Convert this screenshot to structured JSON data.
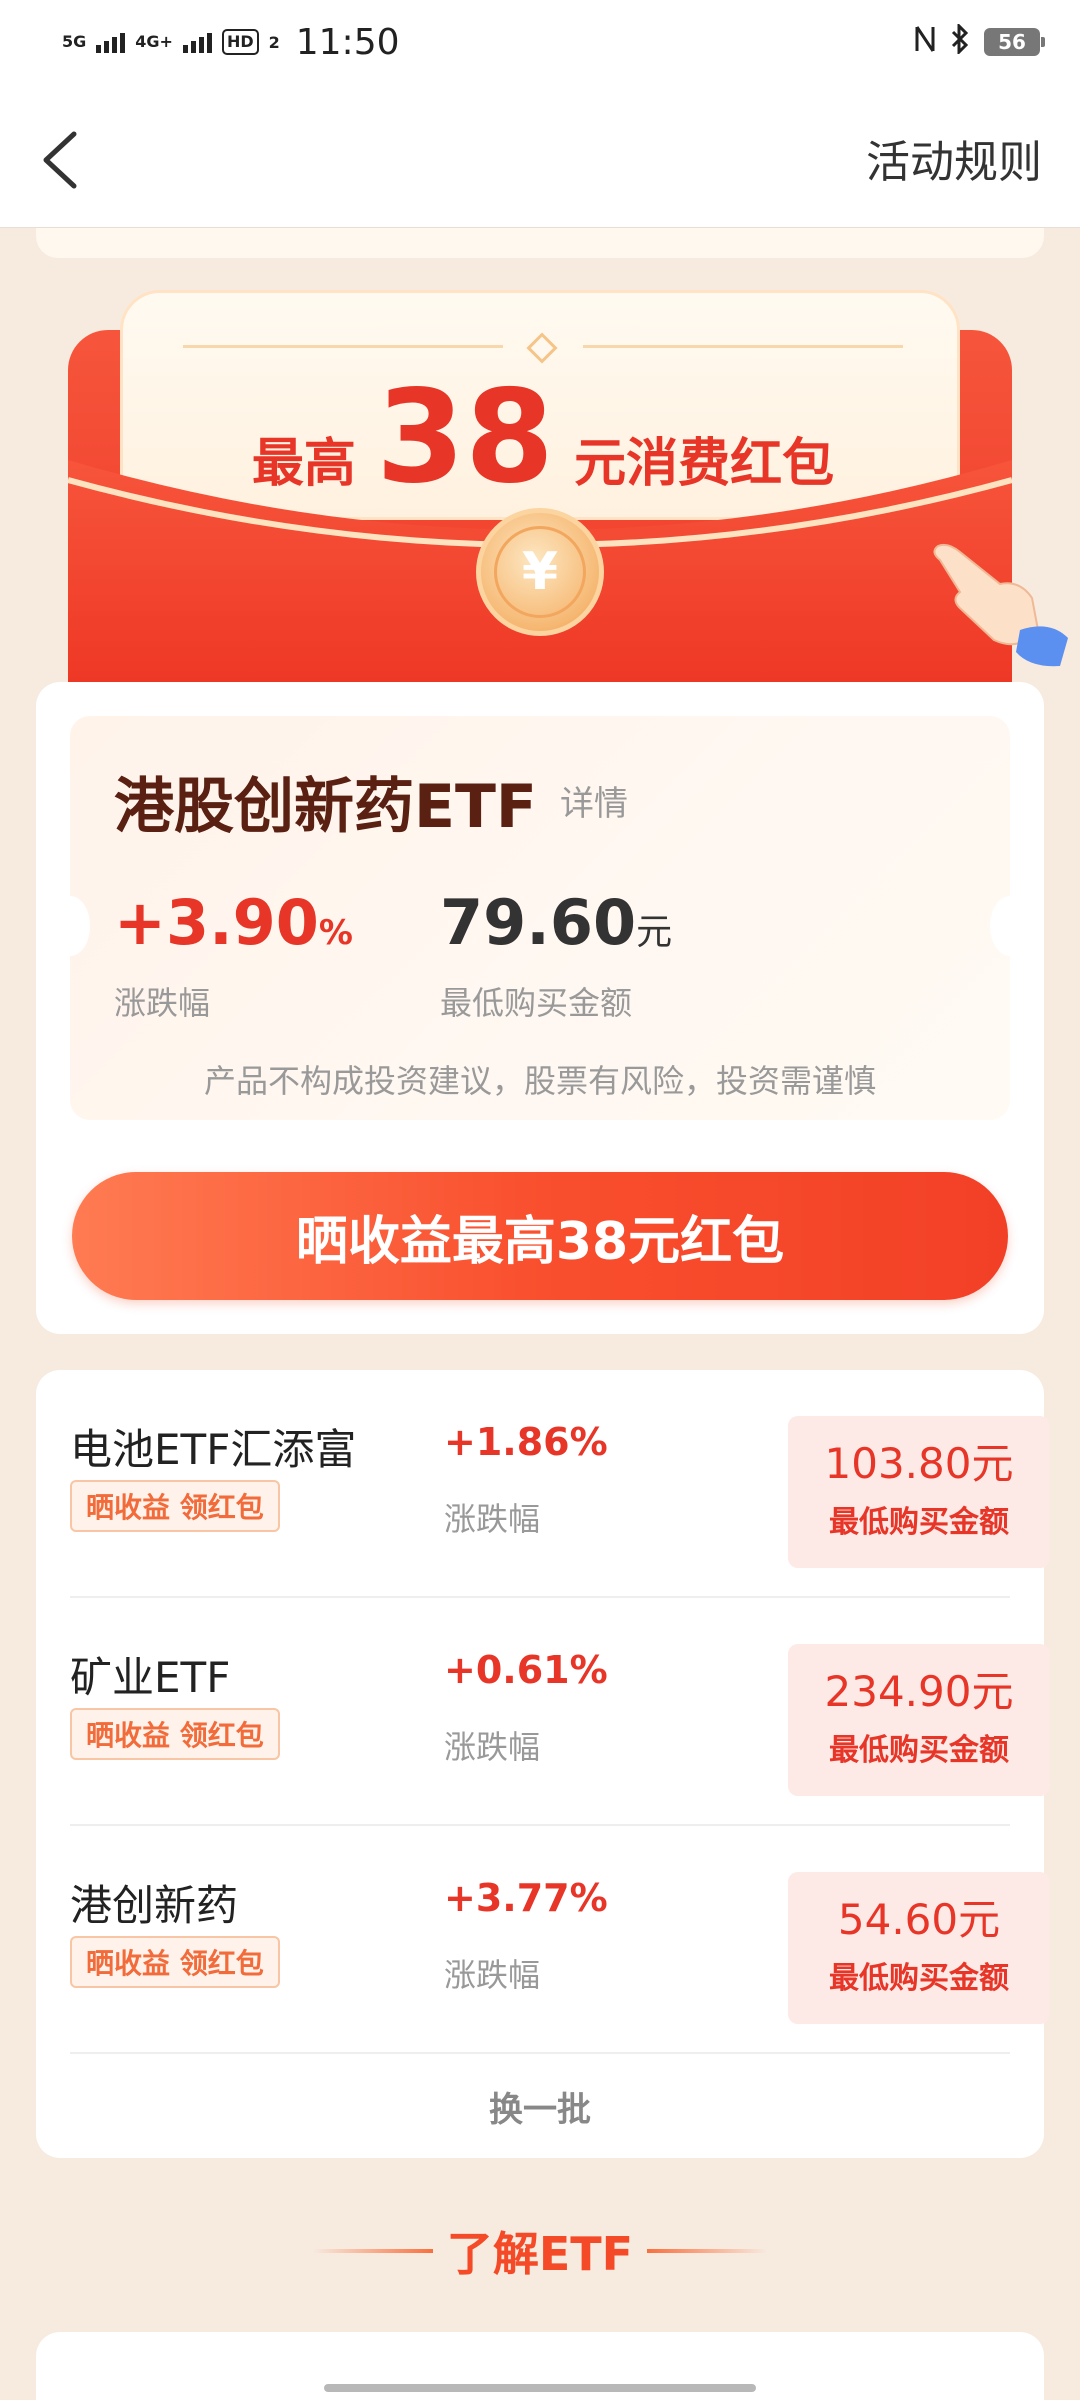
{
  "status_bar": {
    "net1": "5G",
    "net2": "4G+",
    "hd": "HD",
    "hd_sub": "2",
    "time": "11:50",
    "battery": "56"
  },
  "header": {
    "rules_label": "活动规则"
  },
  "envelope": {
    "prefix": "最高",
    "amount": "38",
    "suffix": "元消费红包",
    "coin_symbol": "¥"
  },
  "featured": {
    "name": "港股创新药ETF",
    "detail_label": "详情",
    "change_value": "+3.90",
    "change_unit": "%",
    "change_label": "涨跌幅",
    "price_value": "79.60",
    "price_unit": "元",
    "price_label": "最低购买金额",
    "disclaimer": "产品不构成投资建议，股票有风险，投资需谨慎",
    "cta_label": "晒收益最高38元红包"
  },
  "list": {
    "items": [
      {
        "name": "电池ETF汇添富",
        "tag": "晒收益 领红包",
        "change": "+1.86%",
        "change_label": "涨跌幅",
        "price": "103.80元",
        "price_label": "最低购买金额"
      },
      {
        "name": "矿业ETF",
        "tag": "晒收益 领红包",
        "change": "+0.61%",
        "change_label": "涨跌幅",
        "price": "234.90元",
        "price_label": "最低购买金额"
      },
      {
        "name": "港创新药",
        "tag": "晒收益 领红包",
        "change": "+3.77%",
        "change_label": "涨跌幅",
        "price": "54.60元",
        "price_label": "最低购买金额"
      }
    ],
    "refresh_label": "换一批"
  },
  "learn": {
    "title": "了解ETF"
  },
  "colors": {
    "accent_red": "#e73527",
    "cta_orange": "#f94f2e",
    "page_bg": "#f7eadf"
  }
}
